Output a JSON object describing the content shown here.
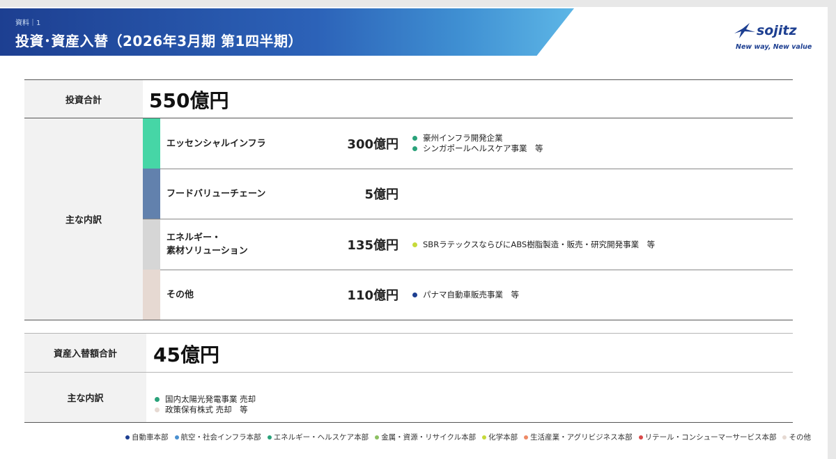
{
  "header": {
    "breadcrumb": "資料｜1",
    "title": "投資･資産入替（2026年3月期 第1四半期）",
    "logo_word": "sojitz",
    "logo_tagline": "New way, New value"
  },
  "investment": {
    "total_label": "投資合計",
    "total_value": "550億円",
    "breakdown_label": "主な内訳",
    "segments": [
      {
        "name_line1": "エッセンシャルインフラ",
        "name_line2": "",
        "value": "300億円",
        "color": "#46d6a6",
        "notes": [
          {
            "text": "豪州インフラ開発企業",
            "color": "#2aa27a"
          },
          {
            "text": "シンガポールヘルスケア事業　等",
            "color": "#2aa27a"
          }
        ]
      },
      {
        "name_line1": "フードバリューチェーン",
        "name_line2": "",
        "value": "5億円",
        "color": "#6281ad",
        "notes": []
      },
      {
        "name_line1": "エネルギー・",
        "name_line2": "素材ソリューション",
        "value": "135億円",
        "color": "#d6d6d6",
        "notes": [
          {
            "text": "SBRラテックスならびにABS樹脂製造・販売・研究開発事業　等",
            "color": "#c6da3a"
          }
        ]
      },
      {
        "name_line1": "その他",
        "name_line2": "",
        "value": "110億円",
        "color": "#e6d9d2",
        "notes": [
          {
            "text": "パナマ自動車販売事業　等",
            "color": "#1d3f91"
          }
        ]
      }
    ]
  },
  "asset_replacement": {
    "total_label": "資産入替額合計",
    "total_value": "45億円",
    "breakdown_label": "主な内訳",
    "notes": [
      {
        "text": "国内太陽光発電事業 売却",
        "color": "#2aa27a"
      },
      {
        "text": "政策保有株式 売却　等",
        "color": "#e6d9d2"
      }
    ]
  },
  "legend": [
    {
      "label": "自動車本部",
      "color": "#1d3f91"
    },
    {
      "label": "航空・社会インフラ本部",
      "color": "#4a90d0"
    },
    {
      "label": "エネルギー・ヘルスケア本部",
      "color": "#2aa27a"
    },
    {
      "label": "金属・資源・リサイクル本部",
      "color": "#8cc062"
    },
    {
      "label": "化学本部",
      "color": "#c6da3a"
    },
    {
      "label": "生活産業・アグリビジネス本部",
      "color": "#ee8a66"
    },
    {
      "label": "リテール・コンシューマーサービス本部",
      "color": "#d94a4a"
    },
    {
      "label": "その他",
      "color": "#e6d9d2"
    }
  ]
}
